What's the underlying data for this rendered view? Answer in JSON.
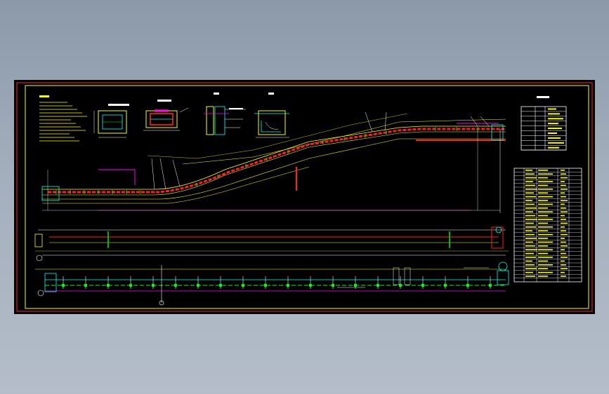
{
  "colors": {
    "background": "#000000",
    "frame_outer": "#ff2a2a",
    "frame_inner": "#ffff00",
    "main_line": "#ffff00",
    "chain": "#ff2020",
    "dimension": "#ffffff",
    "section": "#00ffff",
    "magenta": "#ff00ff",
    "green": "#00ff00",
    "page_top": "#8b99a9",
    "page_bottom": "#b4bdc9"
  },
  "icons": [
    "cad-drawing-sheet",
    "section-view-icon",
    "table-icon"
  ]
}
